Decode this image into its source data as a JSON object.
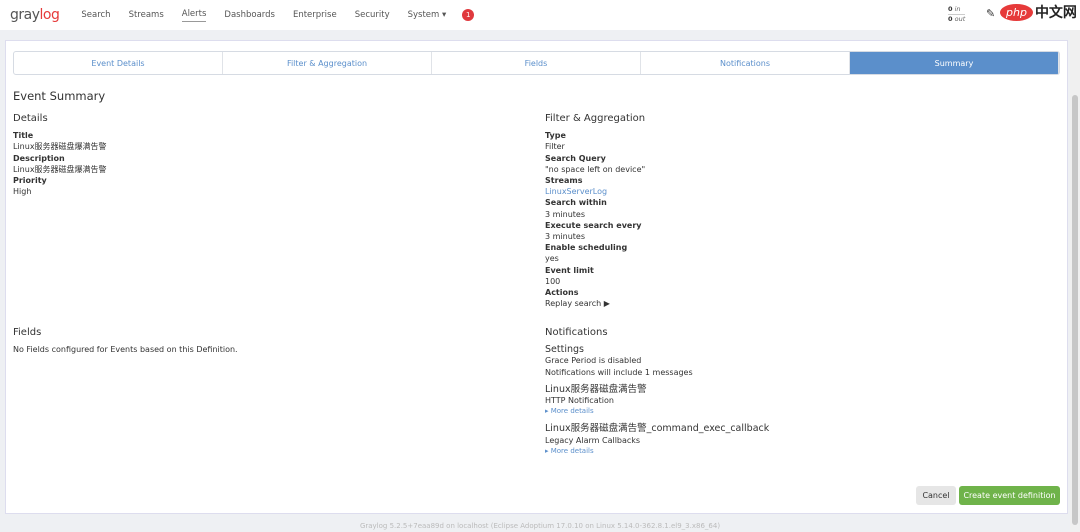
{
  "nav": {
    "logo_left": "gray",
    "logo_right": "log",
    "items": [
      "Search",
      "Streams",
      "Alerts",
      "Dashboards",
      "Enterprise",
      "Security",
      "System ▾"
    ],
    "active": "Alerts",
    "notifications": "1",
    "throughput_in": "0",
    "in_label": "in",
    "throughput_out": "0",
    "out_label": "out"
  },
  "watermark": {
    "php": "php",
    "cn": "中文网"
  },
  "steps": [
    "Event Details",
    "Filter & Aggregation",
    "Fields",
    "Notifications",
    "Summary"
  ],
  "title": "Event Summary",
  "details": {
    "heading": "Details",
    "title_label": "Title",
    "title": "Linux服务器磁盘爆满告警",
    "desc_label": "Description",
    "desc": "Linux服务器磁盘爆满告警",
    "priority_label": "Priority",
    "priority": "High"
  },
  "filter": {
    "heading": "Filter & Aggregation",
    "type_label": "Type",
    "type": "Filter",
    "query_label": "Search Query",
    "query": "\"no space left on device\"",
    "streams_label": "Streams",
    "stream": "LinuxServerLog",
    "within_label": "Search within",
    "within": "3 minutes",
    "every_label": "Execute search every",
    "every": "3 minutes",
    "sched_label": "Enable scheduling",
    "sched": "yes",
    "limit_label": "Event limit",
    "limit": "100",
    "actions_label": "Actions",
    "replay": "Replay search ▶"
  },
  "fields": {
    "heading": "Fields",
    "text": "No Fields configured for Events based on this Definition."
  },
  "notifications": {
    "heading": "Notifications",
    "settings": "Settings",
    "grace": "Grace Period is disabled",
    "include": "Notifications will include 1 messages",
    "items": [
      {
        "name": "Linux服务器磁盘满告警",
        "type": "HTTP Notification",
        "more": "▸ More details"
      },
      {
        "name": "Linux服务器磁盘满告警_command_exec_callback",
        "type": "Legacy Alarm Callbacks",
        "more": "▸ More details"
      }
    ]
  },
  "buttons": {
    "cancel": "Cancel",
    "create": "Create event definition"
  },
  "footer": "Graylog 5.2.5+7eaa89d on localhost (Eclipse Adoptium 17.0.10 on Linux 5.14.0-362.8.1.el9_3.x86_64)"
}
